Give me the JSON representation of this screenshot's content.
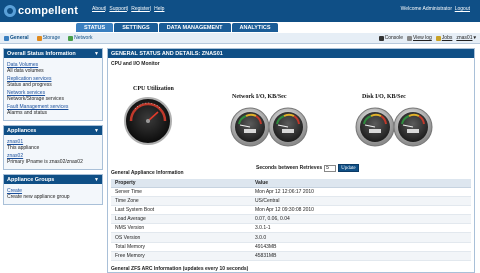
{
  "header": {
    "logo": "compellent",
    "links": [
      "About",
      "Support",
      "Register",
      "Help"
    ],
    "welcome": "Welcome Administrator",
    "logout": "Logout"
  },
  "nav": {
    "tabs": [
      "STATUS",
      "SETTINGS",
      "DATA MANAGEMENT",
      "ANALYTICS"
    ],
    "active": "STATUS"
  },
  "subnav": {
    "left": [
      "General",
      "Storage",
      "Network"
    ],
    "right": [
      "Console",
      "View log",
      "Jobs",
      "znas01"
    ]
  },
  "sidebar": {
    "overall": {
      "title": "Overall Status Information",
      "items": [
        {
          "label": "Data Volumes",
          "desc": "All data volumes"
        },
        {
          "label": "Replication services",
          "desc": "Status and progress"
        },
        {
          "label": "Network services",
          "desc": "Network/Storage services"
        },
        {
          "label": "Fault Management services",
          "desc": "Alarms and status"
        }
      ]
    },
    "appliances": {
      "title": "Appliances",
      "items": [
        {
          "label": "znas01",
          "desc": "This appliance"
        },
        {
          "label": "znas02",
          "desc": "Primary IPname is znas02/znas02"
        }
      ]
    },
    "groups": {
      "title": "Appliance Groups",
      "items": [
        {
          "label": "Create",
          "desc": "Create new appliance group"
        }
      ]
    }
  },
  "content": {
    "title": "GENERAL STATUS AND DETAILS: ZNAS01",
    "monitor_title": "CPU and I/O Monitor",
    "gauges": {
      "cpu_label": "CPU Utilization",
      "net_label": "Network I/O, KB/Sec",
      "disk_label": "Disk I/O, KB/Sec"
    },
    "retrieve_label": "Seconds between Retrieves",
    "retrieve_value": "5",
    "update_label": "Update",
    "appinfo_title": "General Appliance Information",
    "table_headers": [
      "Property",
      "Value"
    ],
    "table_rows": [
      [
        "Server Time",
        "Mon Apr 12 12:06:17 2010"
      ],
      [
        "Time Zone",
        "US/Central"
      ],
      [
        "Last System Boot",
        "Mon Apr 12 09:30:08 2010"
      ],
      [
        "Load Average",
        "0.07, 0.06, 0.04"
      ],
      [
        "NMS Version",
        "3.0.1-1"
      ],
      [
        "OS Version",
        "3.0.0"
      ],
      [
        "Total Memory",
        "49143MB"
      ],
      [
        "Free Memory",
        "45831MB"
      ]
    ],
    "zfs_title": "General ZFS ARC Information (updates every 10 seconds)"
  },
  "colors": {
    "header": "#0f4f86",
    "accent": "#3a7fc0",
    "gauge_red": "#c0392b",
    "gauge_green": "#2e8b3d"
  }
}
